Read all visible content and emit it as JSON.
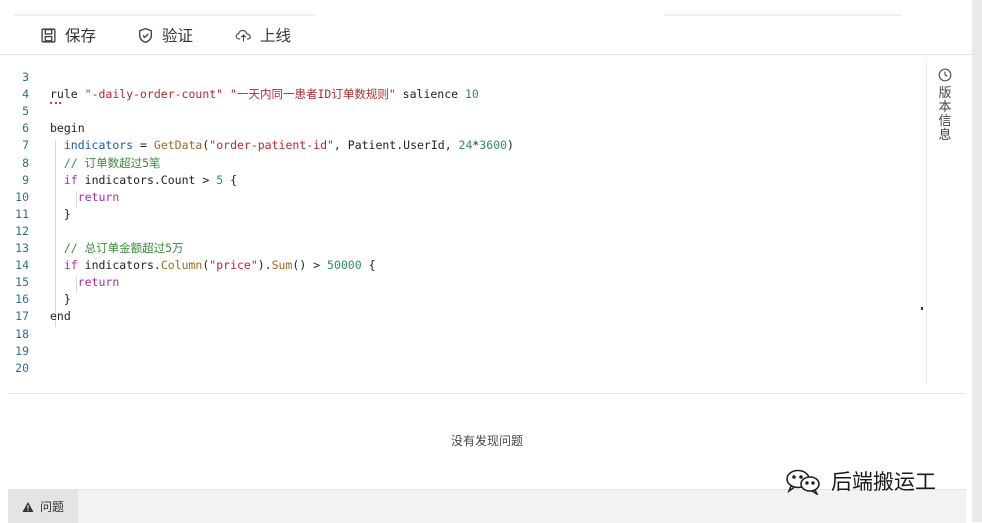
{
  "toolbar": {
    "save_label": "保存",
    "validate_label": "验证",
    "deploy_label": "上线"
  },
  "editor": {
    "lines": [
      {
        "n": "3",
        "segments": []
      },
      {
        "n": "4",
        "segments": [
          {
            "t": "rule ",
            "c": ""
          },
          {
            "t": "\"-daily-order-count\"",
            "c": "t-str"
          },
          {
            "t": " ",
            "c": ""
          },
          {
            "t": "\"一天内同一患者ID订单数规则\"",
            "c": "t-str"
          },
          {
            "t": " salience ",
            "c": ""
          },
          {
            "t": "10",
            "c": "t-num"
          }
        ]
      },
      {
        "n": "5",
        "segments": []
      },
      {
        "n": "6",
        "segments": [
          {
            "t": "begin",
            "c": ""
          }
        ]
      },
      {
        "n": "7",
        "segments": [
          {
            "t": "  ",
            "c": ""
          },
          {
            "t": "indicators",
            "c": "t-var"
          },
          {
            "t": " = ",
            "c": ""
          },
          {
            "t": "GetData",
            "c": "t-fn"
          },
          {
            "t": "(",
            "c": ""
          },
          {
            "t": "\"order-patient-id\"",
            "c": "t-str"
          },
          {
            "t": ", Patient.UserId, ",
            "c": ""
          },
          {
            "t": "24",
            "c": "t-num"
          },
          {
            "t": "*",
            "c": ""
          },
          {
            "t": "3600",
            "c": "t-num"
          },
          {
            "t": ")",
            "c": ""
          }
        ]
      },
      {
        "n": "8",
        "segments": [
          {
            "t": "  ",
            "c": ""
          },
          {
            "t": "// 订单数超过5笔",
            "c": "t-cmt"
          }
        ]
      },
      {
        "n": "9",
        "segments": [
          {
            "t": "  ",
            "c": ""
          },
          {
            "t": "if",
            "c": "t-kw"
          },
          {
            "t": " indicators.Count > ",
            "c": ""
          },
          {
            "t": "5",
            "c": "t-num"
          },
          {
            "t": " {",
            "c": ""
          }
        ]
      },
      {
        "n": "10",
        "segments": [
          {
            "t": "    ",
            "c": ""
          },
          {
            "t": "return",
            "c": "t-kw"
          }
        ]
      },
      {
        "n": "11",
        "segments": [
          {
            "t": "  }",
            "c": ""
          }
        ]
      },
      {
        "n": "12",
        "segments": []
      },
      {
        "n": "13",
        "segments": [
          {
            "t": "  ",
            "c": ""
          },
          {
            "t": "// 总订单金额超过5万",
            "c": "t-cmt"
          }
        ]
      },
      {
        "n": "14",
        "segments": [
          {
            "t": "  ",
            "c": ""
          },
          {
            "t": "if",
            "c": "t-kw"
          },
          {
            "t": " indicators.",
            "c": ""
          },
          {
            "t": "Column",
            "c": "t-fn"
          },
          {
            "t": "(",
            "c": ""
          },
          {
            "t": "\"price\"",
            "c": "t-str"
          },
          {
            "t": ").",
            "c": ""
          },
          {
            "t": "Sum",
            "c": "t-fn"
          },
          {
            "t": "() > ",
            "c": ""
          },
          {
            "t": "50000",
            "c": "t-num"
          },
          {
            "t": " {",
            "c": ""
          }
        ]
      },
      {
        "n": "15",
        "segments": [
          {
            "t": "    ",
            "c": ""
          },
          {
            "t": "return",
            "c": "t-kw"
          }
        ]
      },
      {
        "n": "16",
        "segments": [
          {
            "t": "  }",
            "c": ""
          }
        ]
      },
      {
        "n": "17",
        "segments": [
          {
            "t": "end",
            "c": ""
          }
        ]
      },
      {
        "n": "18",
        "segments": []
      },
      {
        "n": "19",
        "segments": []
      },
      {
        "n": "20",
        "segments": []
      }
    ]
  },
  "side_panel": {
    "history_label": "版本信息"
  },
  "problems_panel": {
    "empty_text": "没有发现问题",
    "tab_label": "问题"
  },
  "watermark": {
    "text": "后端搬运工"
  }
}
